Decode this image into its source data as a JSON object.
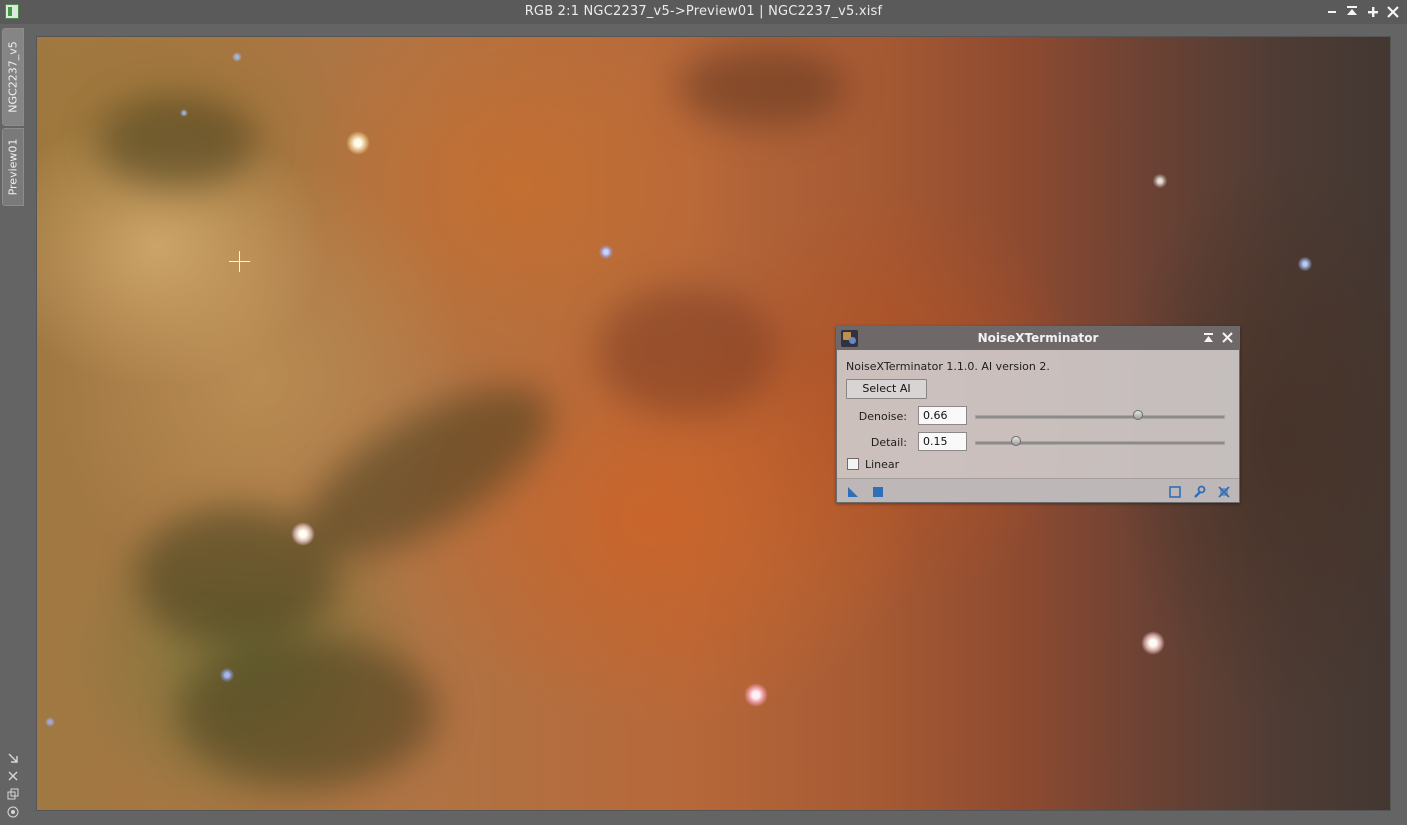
{
  "window": {
    "title": "RGB 2:1 NGC2237_v5->Preview01 | NGC2237_v5.xisf",
    "controls": [
      "shade",
      "maximize",
      "close"
    ]
  },
  "tabs": [
    {
      "label": "NGC2237_v5"
    },
    {
      "label": "Preview01"
    }
  ],
  "side_tools": [
    "arrow-icon",
    "fit-icon",
    "copy-icon",
    "settings-icon"
  ],
  "dialog": {
    "title": "NoiseXTerminator",
    "version_text": "NoiseXTerminator 1.1.0. AI version 2.",
    "select_ai_label": "Select AI",
    "denoise": {
      "label": "Denoise:",
      "value": "0.66",
      "slider_fraction": 0.66
    },
    "detail": {
      "label": "Detail:",
      "value": "0.15",
      "slider_fraction": 0.15
    },
    "linear": {
      "label": "Linear",
      "checked": false
    }
  },
  "colors": {
    "accent": "#2f6fb8",
    "dialog_title_bg": "#6e6868"
  }
}
